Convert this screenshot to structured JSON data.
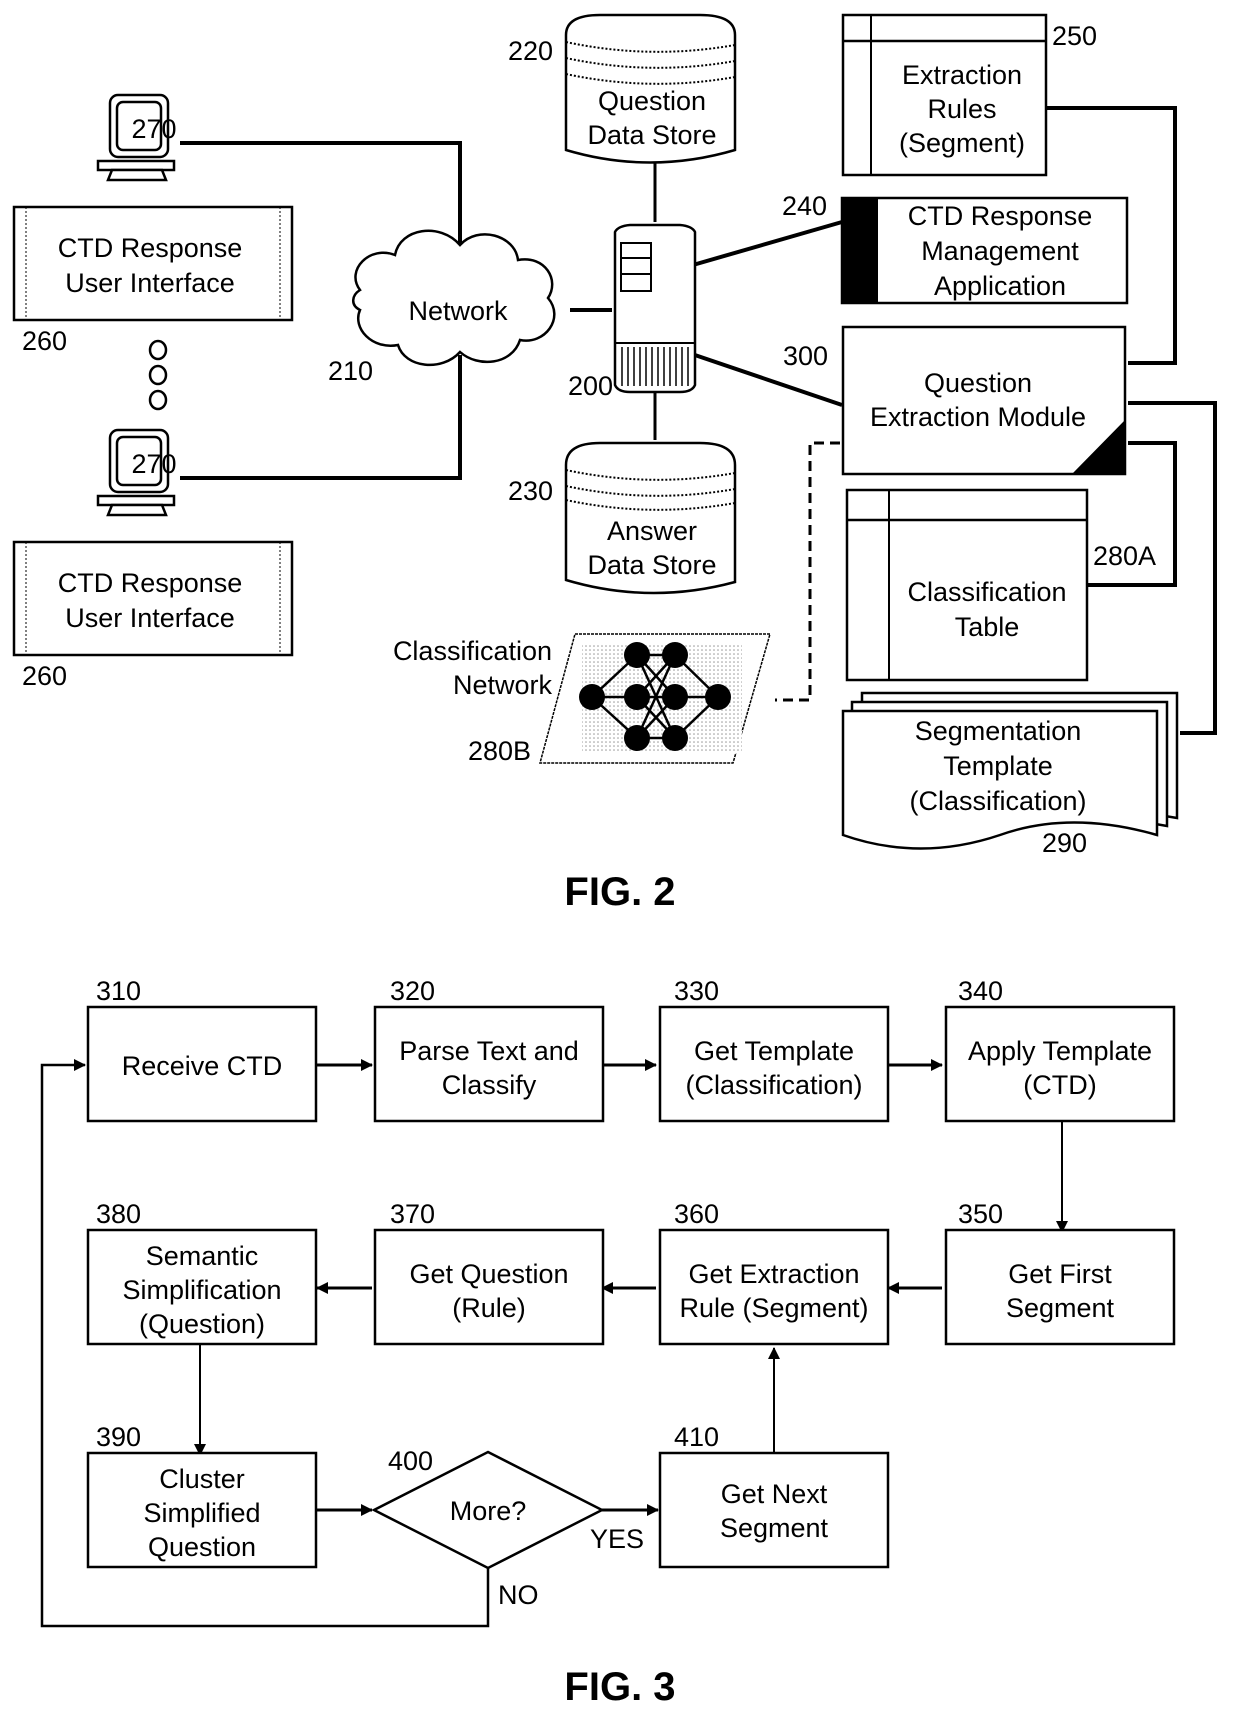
{
  "fig2": {
    "caption": "FIG. 2",
    "terminals": [
      {
        "ref": "270",
        "ui_ref": "260",
        "ui_label": [
          "CTD Response",
          "User Interface"
        ]
      },
      {
        "ref": "270",
        "ui_ref": "260",
        "ui_label": [
          "CTD Response",
          "User Interface"
        ]
      }
    ],
    "network": {
      "ref": "210",
      "label": "Network"
    },
    "server": {
      "ref": "200"
    },
    "question_store": {
      "ref": "220",
      "label": [
        "Question",
        "Data Store"
      ]
    },
    "answer_store": {
      "ref": "230",
      "label": [
        "Answer",
        "Data Store"
      ]
    },
    "extraction_rules": {
      "ref": "250",
      "label": [
        "Extraction",
        "Rules",
        "(Segment)"
      ]
    },
    "mgmt_app": {
      "ref": "240",
      "label": [
        "CTD Response",
        "Management",
        "Application"
      ]
    },
    "qem": {
      "ref": "300",
      "label": [
        "Question",
        "Extraction Module"
      ]
    },
    "class_table": {
      "ref": "280A",
      "label": [
        "Classification",
        "Table"
      ]
    },
    "class_network": {
      "ref": "280B",
      "label": [
        "Classification",
        "Network"
      ]
    },
    "seg_template": {
      "ref": "290",
      "label": [
        "Segmentation",
        "Template",
        "(Classification)"
      ]
    }
  },
  "fig3": {
    "caption": "FIG. 3",
    "steps": [
      {
        "ref": "310",
        "label": [
          "Receive CTD"
        ]
      },
      {
        "ref": "320",
        "label": [
          "Parse Text and",
          "Classify"
        ]
      },
      {
        "ref": "330",
        "label": [
          "Get Template",
          "(Classification)"
        ]
      },
      {
        "ref": "340",
        "label": [
          "Apply Template",
          "(CTD)"
        ]
      },
      {
        "ref": "350",
        "label": [
          "Get First",
          "Segment"
        ]
      },
      {
        "ref": "360",
        "label": [
          "Get Extraction",
          "Rule (Segment)"
        ]
      },
      {
        "ref": "370",
        "label": [
          "Get Question",
          "(Rule)"
        ]
      },
      {
        "ref": "380",
        "label": [
          "Semantic",
          "Simplification",
          "(Question)"
        ]
      },
      {
        "ref": "390",
        "label": [
          "Cluster",
          "Simplified",
          "Question"
        ]
      },
      {
        "ref": "410",
        "label": [
          "Get Next",
          "Segment"
        ]
      }
    ],
    "decision": {
      "ref": "400",
      "label": "More?",
      "yes": "YES",
      "no": "NO"
    }
  }
}
